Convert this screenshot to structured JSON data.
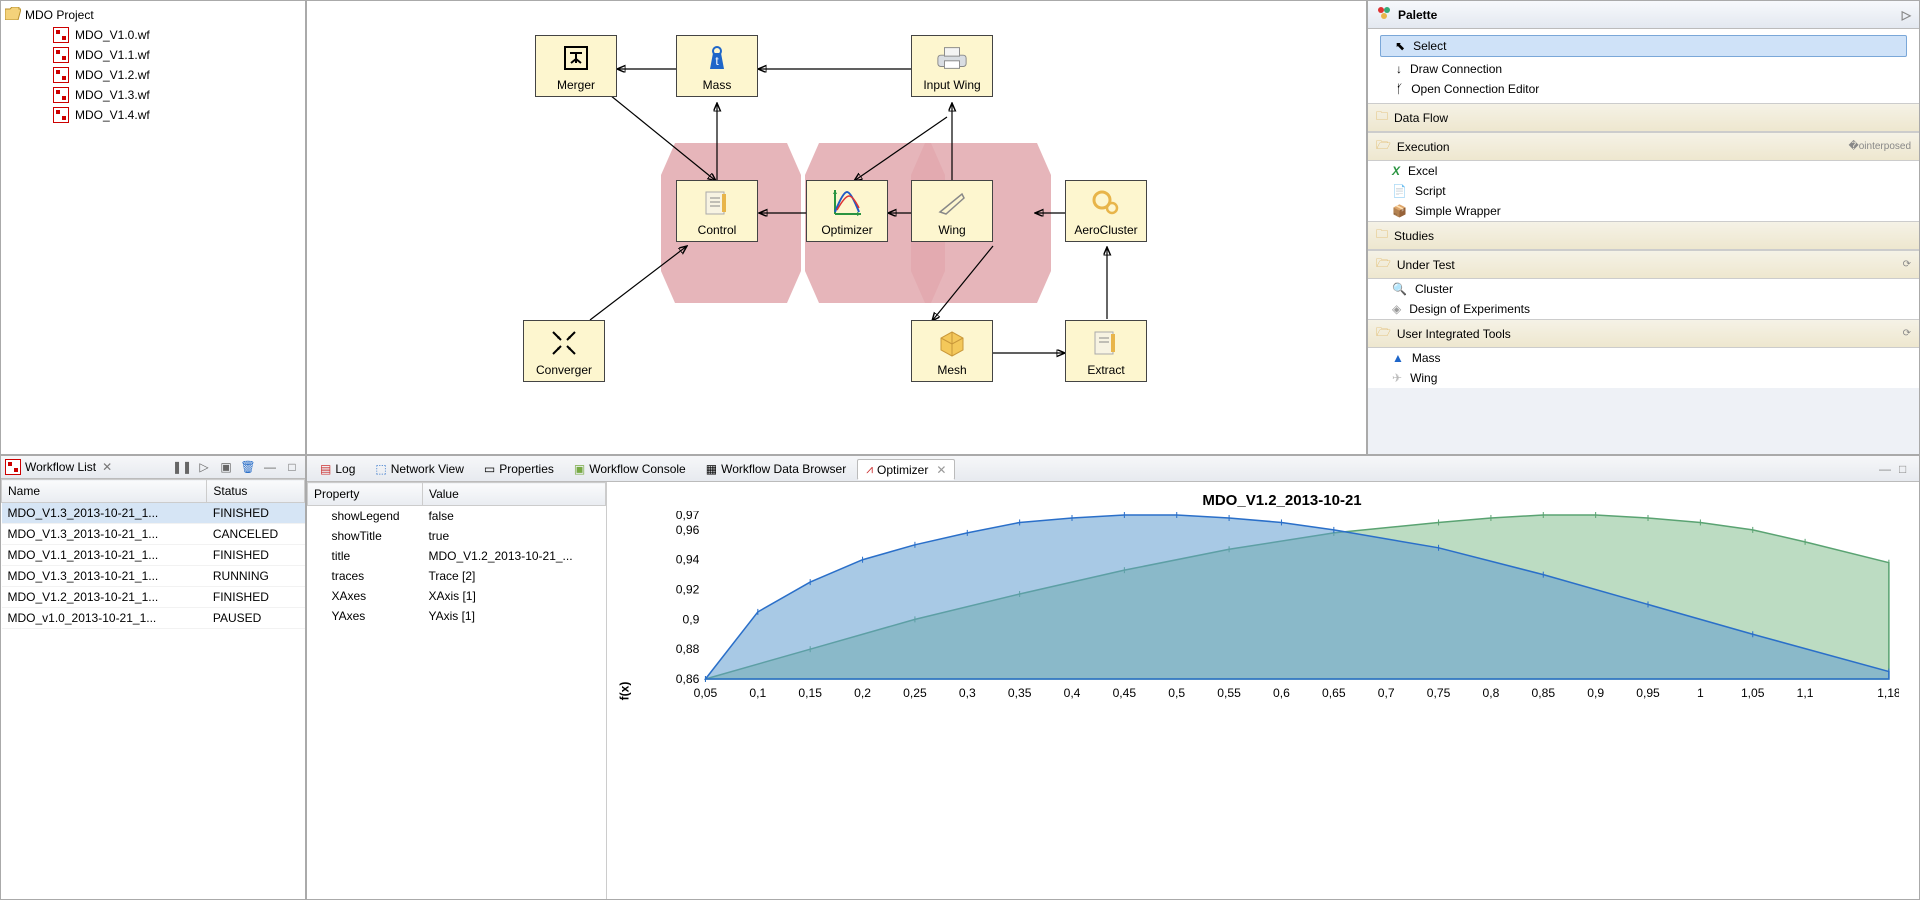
{
  "project": {
    "name": "MDO Project",
    "files": [
      "MDO_V1.0.wf",
      "MDO_V1.1.wf",
      "MDO_V1.2.wf",
      "MDO_V1.3.wf",
      "MDO_V1.4.wf"
    ]
  },
  "canvas": {
    "nodes": {
      "merger": "Merger",
      "mass": "Mass",
      "inputwing": "Input Wing",
      "control": "Control",
      "optimizer": "Optimizer",
      "wing": "Wing",
      "aerocluster": "AeroCluster",
      "converger": "Converger",
      "mesh": "Mesh",
      "extract": "Extract"
    }
  },
  "palette": {
    "title": "Palette",
    "tools": {
      "select": "Select",
      "draw": "Draw Connection",
      "open": "Open Connection Editor"
    },
    "groups": {
      "dataflow": "Data Flow",
      "execution": "Execution",
      "studies": "Studies",
      "undertest": "Under Test",
      "userint": "User Integrated Tools"
    },
    "execution_items": {
      "excel": "Excel",
      "script": "Script",
      "wrapper": "Simple Wrapper"
    },
    "undertest_items": {
      "cluster": "Cluster",
      "doe": "Design of Experiments"
    },
    "userint_items": {
      "mass": "Mass",
      "wing": "Wing"
    }
  },
  "workflow_list": {
    "title": "Workflow List",
    "columns": {
      "name": "Name",
      "status": "Status"
    },
    "rows": [
      {
        "name": "MDO_V1.3_2013-10-21_1...",
        "status": "FINISHED"
      },
      {
        "name": "MDO_V1.3_2013-10-21_1...",
        "status": "CANCELED"
      },
      {
        "name": "MDO_V1.1_2013-10-21_1...",
        "status": "FINISHED"
      },
      {
        "name": "MDO_V1.3_2013-10-21_1...",
        "status": "RUNNING"
      },
      {
        "name": "MDO_V1.2_2013-10-21_1...",
        "status": "FINISHED"
      },
      {
        "name": "MDO_v1.0_2013-10-21_1...",
        "status": "PAUSED"
      }
    ]
  },
  "bottom_tabs": {
    "log": "Log",
    "network": "Network View",
    "properties": "Properties",
    "console": "Workflow Console",
    "browser": "Workflow Data Browser",
    "optimizer": "Optimizer"
  },
  "properties": {
    "header_prop": "Property",
    "header_val": "Value",
    "rows": [
      {
        "k": "showLegend",
        "v": "false"
      },
      {
        "k": "showTitle",
        "v": "true"
      },
      {
        "k": "title",
        "v": "MDO_V1.2_2013-10-21_..."
      },
      {
        "k": "traces",
        "v": "Trace [2]"
      },
      {
        "k": "XAxes",
        "v": "XAxis [1]"
      },
      {
        "k": "YAxes",
        "v": "YAxis [1]"
      }
    ]
  },
  "chart_data": {
    "type": "area",
    "title": "MDO_V1.2_2013-10-21",
    "ylabel": "f(x)",
    "xlim": [
      0.05,
      1.18
    ],
    "ylim": [
      0.86,
      0.97
    ],
    "x_ticks": [
      0.05,
      0.1,
      0.15,
      0.2,
      0.25,
      0.3,
      0.35,
      0.4,
      0.45,
      0.5,
      0.55,
      0.6,
      0.65,
      0.7,
      0.75,
      0.8,
      0.85,
      0.9,
      0.95,
      1,
      1.05,
      1.1,
      1.18
    ],
    "y_ticks": [
      0.86,
      0.88,
      0.9,
      0.92,
      0.94,
      0.96,
      0.97
    ],
    "series": [
      {
        "name": "blue",
        "color": "#2a6fc9",
        "fill": "rgba(97,157,208,0.55)",
        "x": [
          0.05,
          0.1,
          0.15,
          0.2,
          0.25,
          0.3,
          0.35,
          0.4,
          0.45,
          0.5,
          0.55,
          0.6,
          0.65,
          0.75,
          0.85,
          0.95,
          1.05,
          1.18
        ],
        "y": [
          0.86,
          0.905,
          0.925,
          0.94,
          0.95,
          0.958,
          0.965,
          0.968,
          0.97,
          0.97,
          0.968,
          0.965,
          0.96,
          0.948,
          0.93,
          0.91,
          0.89,
          0.865
        ]
      },
      {
        "name": "green",
        "color": "#5aa372",
        "fill": "rgba(143,197,153,0.6)",
        "x": [
          0.05,
          0.15,
          0.25,
          0.35,
          0.45,
          0.55,
          0.65,
          0.75,
          0.8,
          0.85,
          0.9,
          0.95,
          1.0,
          1.05,
          1.1,
          1.18
        ],
        "y": [
          0.86,
          0.88,
          0.9,
          0.917,
          0.933,
          0.947,
          0.958,
          0.965,
          0.968,
          0.97,
          0.97,
          0.968,
          0.965,
          0.96,
          0.952,
          0.938
        ]
      }
    ]
  }
}
